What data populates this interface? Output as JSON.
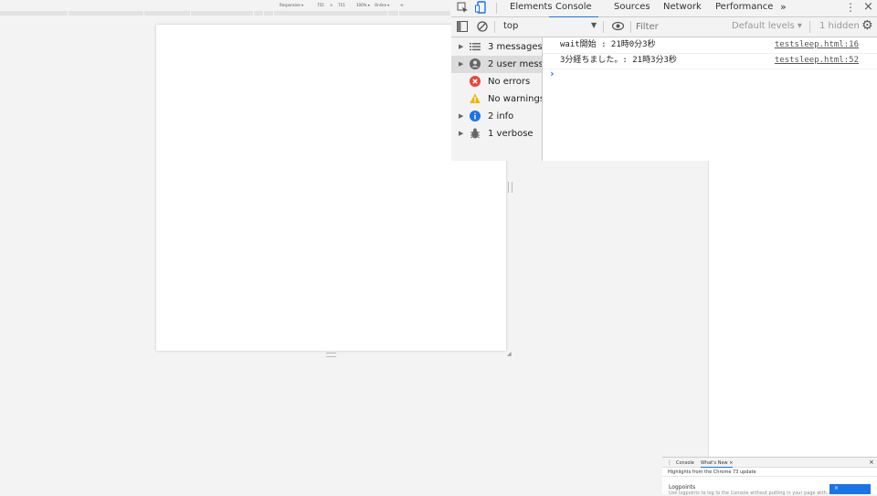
{
  "device_toolbar": {
    "device": "Responsive ▾",
    "width": "755",
    "x": "×",
    "height": "715",
    "zoom": "100% ▾",
    "throttle": "Online ▾"
  },
  "devtools": {
    "tabs": [
      "Elements",
      "Console",
      "Sources",
      "Network",
      "Performance"
    ],
    "active_tab": "Console",
    "more": "»",
    "context": "top",
    "filter_placeholder": "Filter",
    "levels": "Default levels ▾",
    "hidden": "1 hidden",
    "sidebar": [
      {
        "label": "3 messages",
        "expandable": true,
        "icon": "list-icon"
      },
      {
        "label": "2 user mess...",
        "expandable": true,
        "icon": "user-icon",
        "selected": true
      },
      {
        "label": "No errors",
        "expandable": false,
        "icon": "error-icon"
      },
      {
        "label": "No warnings",
        "expandable": false,
        "icon": "warning-icon"
      },
      {
        "label": "2 info",
        "expandable": true,
        "icon": "info-icon"
      },
      {
        "label": "1 verbose",
        "expandable": true,
        "icon": "bug-icon"
      }
    ],
    "messages": [
      {
        "text": "wait開始 : 21時0分3秒",
        "source": "testsleep.html:16"
      },
      {
        "text": "3分経ちました。: 21時3分3秒",
        "source": "testsleep.html:52"
      }
    ],
    "prompt": "›"
  },
  "drawer": {
    "tabs": [
      "Console",
      "What's New ×"
    ],
    "close": "×",
    "headline": "Highlights from the Chrome 73 update",
    "item_title": "Logpoints",
    "item_desc": "Use logpoints to log to the Console without putting in your page with..."
  },
  "colors": {
    "accent": "#1a73e8",
    "error": "#e8453c",
    "warning": "#f4b400",
    "info": "#1a73e8"
  }
}
